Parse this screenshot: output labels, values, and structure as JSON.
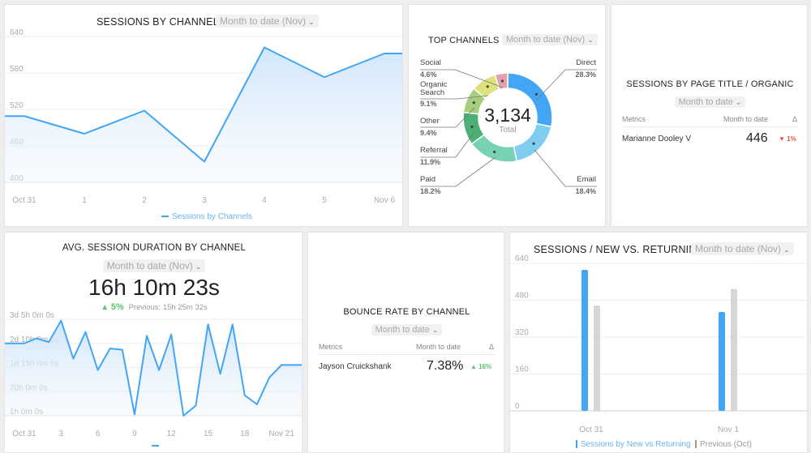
{
  "sessions_by_channel": {
    "title": "SESSIONS BY CHANNEL",
    "dropdown": "Month to date (Nov)",
    "chart_data": {
      "type": "area",
      "categories": [
        "Oct 31",
        "1",
        "2",
        "3",
        "4",
        "5",
        "Nov 6"
      ],
      "series": [
        {
          "name": "Sessions by Channels",
          "values": [
            509,
            480,
            518,
            434,
            622,
            573,
            612
          ]
        }
      ],
      "yticks": [
        "640",
        "580",
        "520",
        "460",
        "400"
      ],
      "ylim": [
        400,
        640
      ],
      "grid": true,
      "legend": "bottom",
      "color": "#42a5f5"
    }
  },
  "top_channels": {
    "title": "TOP CHANNELS",
    "dropdown": "Month to date (Nov)",
    "total": "3,134",
    "total_label": "Total",
    "chart_data": {
      "type": "pie",
      "slices": [
        {
          "name": "Direct",
          "value": 28.3,
          "label": "28.3%",
          "color": "#42a5f5"
        },
        {
          "name": "Email",
          "value": 18.4,
          "label": "18.4%",
          "color": "#7fcdef"
        },
        {
          "name": "Paid",
          "value": 18.2,
          "label": "18.2%",
          "color": "#76d1b5"
        },
        {
          "name": "Referral",
          "value": 11.9,
          "label": "11.9%",
          "color": "#4caf73"
        },
        {
          "name": "Other",
          "value": 9.4,
          "label": "9.4%",
          "color": "#a6cf7c"
        },
        {
          "name": "Organic Search",
          "value": 9.1,
          "label": "9.1%",
          "color": "#dde27a"
        },
        {
          "name": "Social",
          "value": 4.6,
          "label": "4.6%",
          "color": "#e3a2aa"
        }
      ]
    }
  },
  "page_title_organic": {
    "title": "SESSIONS BY PAGE TITLE / ORGANIC",
    "dropdown": "Month to date",
    "headers": [
      "Metrics",
      "Month to date",
      "Δ"
    ],
    "row": {
      "name": "Marianne Dooley V",
      "value": "446",
      "delta": "1%",
      "direction": "down"
    }
  },
  "avg_session_duration": {
    "title": "AVG. SESSION DURATION BY CHANNEL",
    "dropdown": "Month to date (Nov)",
    "value": "16h 10m 23s",
    "delta": "5%",
    "previous": "Previous: 15h 25m 32s",
    "chart_data": {
      "type": "area",
      "x": [
        "Oct 31",
        "Nov 1",
        "Nov 2",
        "Nov 3",
        "Nov 4",
        "Nov 5",
        "Nov 6",
        "Nov 7",
        "Nov 8",
        "Nov 9",
        "Nov 10",
        "Nov 11",
        "Nov 12",
        "Nov 13",
        "Nov 14",
        "Nov 15",
        "Nov 16",
        "Nov 17",
        "Nov 18",
        "Nov 19",
        "Nov 20",
        "Nov 21"
      ],
      "xticks": [
        "Oct 31",
        "3",
        "6",
        "9",
        "12",
        "15",
        "18",
        "Nov 21"
      ],
      "series": [
        {
          "values_hours": [
            58,
            62,
            59,
            76,
            46,
            67,
            37,
            54,
            53,
            2,
            64,
            37,
            65,
            1,
            9,
            73,
            34,
            73,
            17,
            10,
            31,
            41
          ]
        }
      ],
      "yticks": [
        "3d 5h 0m 0s",
        "2d 10h 0m 0s",
        "1d 15h 0m 0s",
        "20h 0m 0s",
        "1h 0m 0s"
      ],
      "ylim_hours": [
        1,
        77
      ],
      "grid": true,
      "color": "#42a5f5"
    }
  },
  "bounce_rate": {
    "title": "BOUNCE RATE BY CHANNEL",
    "dropdown": "Month to date",
    "headers": [
      "Metrics",
      "Month to date",
      "Δ"
    ],
    "row": {
      "name": "Jayson Cruickshank",
      "value": "7.38%",
      "delta": "16%",
      "direction": "up"
    }
  },
  "new_vs_returning": {
    "title": "SESSIONS / NEW VS. RETURNING",
    "dropdown": "Month to date (Nov)",
    "chart_data": {
      "type": "bar",
      "categories": [
        "Oct 31",
        "Nov 1"
      ],
      "series": [
        {
          "name": "Sessions by New vs Returning",
          "values": [
            612,
            429
          ],
          "color": "#42a5f5"
        },
        {
          "name": "Previous (Oct)",
          "values": [
            457,
            529
          ],
          "color": "#d6d6d6"
        }
      ],
      "yticks": [
        "640",
        "480",
        "320",
        "160",
        "0"
      ],
      "ylim": [
        0,
        640
      ],
      "grid": true,
      "legend": "bottom"
    }
  }
}
